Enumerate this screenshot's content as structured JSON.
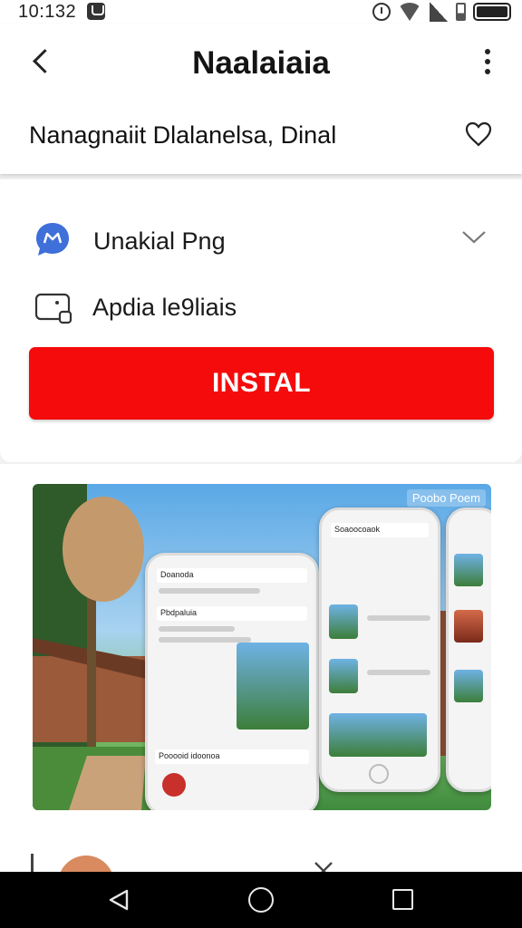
{
  "status": {
    "time": "10:132",
    "icons": [
      "app-notification-icon",
      "alarm-icon",
      "wifi-icon",
      "signal-icon",
      "battery-icon"
    ]
  },
  "header": {
    "title": "Naalaiaia",
    "subtitle": "Nanagnaiit Dlalanelsa, Dinal",
    "back_icon": "back-arrow-icon",
    "menu_icon": "more-vertical-icon",
    "favorite_icon": "heart-icon"
  },
  "details": {
    "row1_label": "Unakial Png",
    "row1_icon": "chat-bubble-icon",
    "row2_label": "Apdia le9liais",
    "row2_icon": "device-icon",
    "expand_icon": "chevron-down-icon"
  },
  "install": {
    "label": "INSTAL"
  },
  "gallery": {
    "caption": "Poobo Poem",
    "phone1_header": "Doanoda",
    "phone1_section": "Pbdpaluia",
    "phone1_footer": "Pooooid idoonoa",
    "phone2_header": "Soaoocoaok"
  },
  "colors": {
    "install_red": "#f50b0b",
    "chat_blue": "#3f6fd8",
    "nav_bar": "#000000"
  }
}
